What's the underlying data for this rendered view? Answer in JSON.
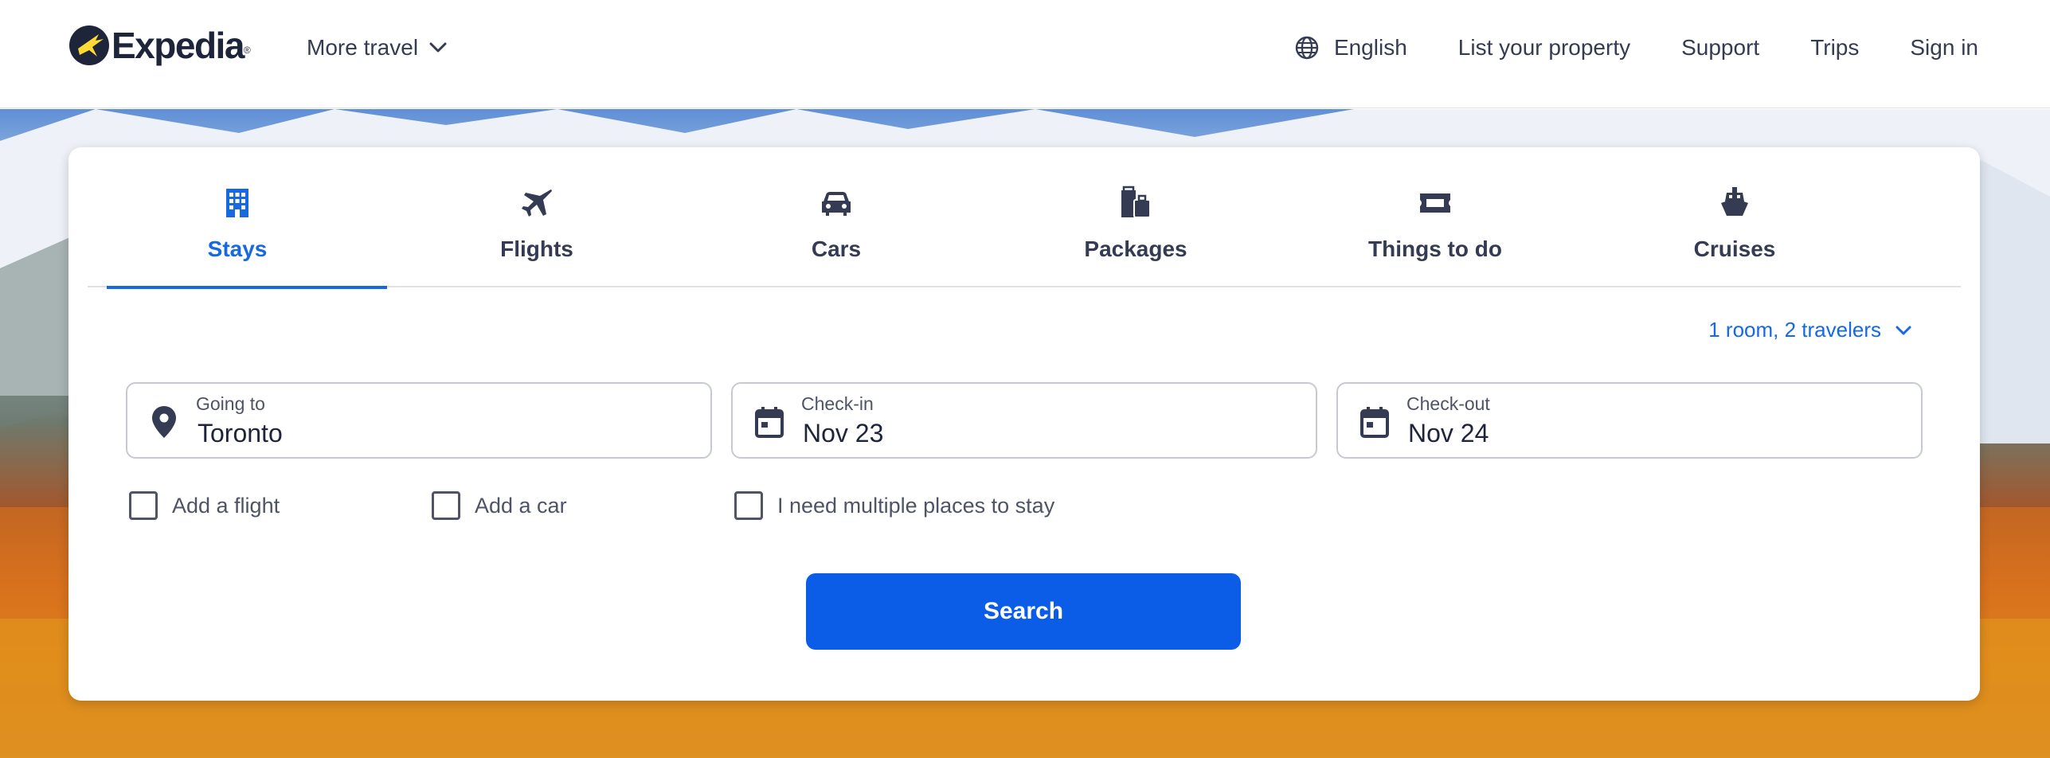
{
  "header": {
    "logo_text": "Expedia",
    "more_travel": "More travel",
    "language": "English",
    "list_property": "List your property",
    "support": "Support",
    "trips": "Trips",
    "sign_in": "Sign in"
  },
  "tabs": [
    {
      "label": "Stays",
      "icon": "building-icon",
      "active": true
    },
    {
      "label": "Flights",
      "icon": "airplane-icon",
      "active": false
    },
    {
      "label": "Cars",
      "icon": "car-icon",
      "active": false
    },
    {
      "label": "Packages",
      "icon": "luggage-icon",
      "active": false
    },
    {
      "label": "Things to do",
      "icon": "ticket-icon",
      "active": false
    },
    {
      "label": "Cruises",
      "icon": "cruise-ship-icon",
      "active": false
    }
  ],
  "travelers": "1 room, 2 travelers",
  "fields": {
    "going_to": {
      "label": "Going to",
      "value": "Toronto"
    },
    "check_in": {
      "label": "Check-in",
      "value": "Nov 23"
    },
    "check_out": {
      "label": "Check-out",
      "value": "Nov 24"
    }
  },
  "options": {
    "add_flight": "Add a flight",
    "add_car": "Add a car",
    "multiple_places": "I need multiple places to stay"
  },
  "search_label": "Search",
  "colors": {
    "accent": "#1668e3",
    "button": "#0b5de8",
    "text": "#343b53",
    "logo_circle": "#1e243a",
    "logo_sun": "#fddb32"
  }
}
